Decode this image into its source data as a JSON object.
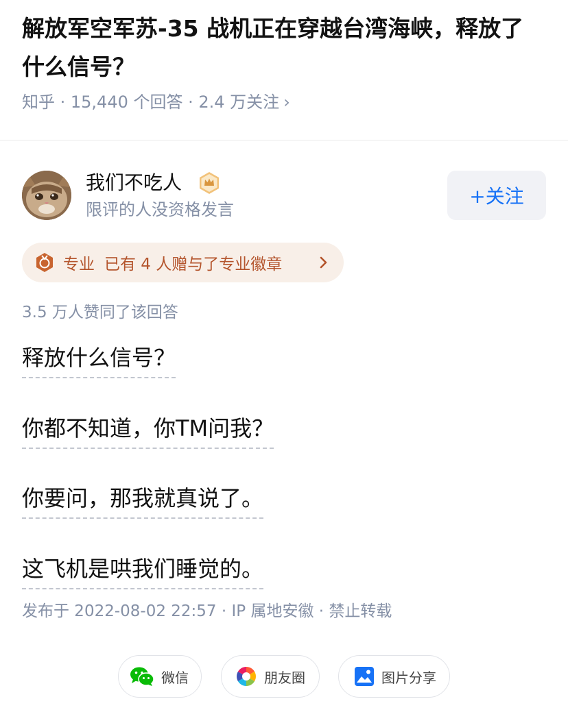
{
  "question": {
    "title": "解放军空军苏-35 战机正在穿越台湾海峡，释放了什么信号？",
    "meta": "知乎 · 15,440 个回答 · 2.4 万关注",
    "meta_chevron": "›"
  },
  "author": {
    "name": "我们不吃人",
    "bio": "限评的人没资格发言",
    "follow_label": "+关注",
    "avatar_icon": "cat-photo-avatar",
    "badge_icon": "crown-badge-icon"
  },
  "pro_badge": {
    "label": "专业",
    "text": "已有 4 人赠与了专业徽章",
    "icon": "medal-icon"
  },
  "answer": {
    "likes": "3.5 万人赞同了该回答",
    "paragraphs": [
      "释放什么信号？",
      "你都不知道，你TM问我？",
      "你要问，那我就真说了。",
      "这飞机是哄我们睡觉的。"
    ],
    "publish_info": "发布于 2022-08-02 22:57 · IP 属地安徽 · 禁止转载"
  },
  "share": {
    "wechat": "微信",
    "moments": "朋友圈",
    "image_share": "图片分享"
  },
  "colors": {
    "accent": "#1772f6",
    "meta_gray": "#8590a6",
    "pro_text": "#b4552d",
    "pro_bg": "#f8efe8",
    "wechat_green": "#09bb07"
  }
}
